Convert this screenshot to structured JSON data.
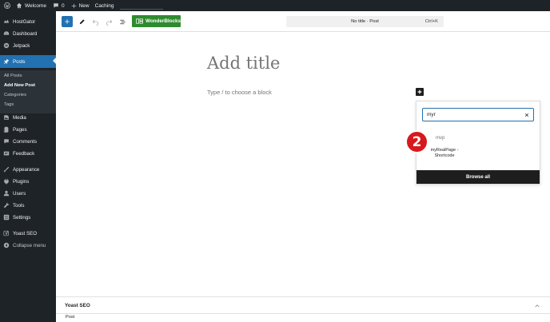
{
  "admin_bar": {
    "site_name": "Welcome",
    "comments_count": "0",
    "new_label": "New",
    "caching_label": "Caching"
  },
  "sidebar": {
    "items": [
      {
        "label": "HostGator",
        "icon": "hostgator-icon"
      },
      {
        "label": "Dashboard",
        "icon": "dashboard-icon"
      },
      {
        "label": "Jetpack",
        "icon": "jetpack-icon"
      },
      {
        "label": "Posts",
        "icon": "pin-icon",
        "active": true
      },
      {
        "label": "Media",
        "icon": "media-icon"
      },
      {
        "label": "Pages",
        "icon": "pages-icon"
      },
      {
        "label": "Comments",
        "icon": "comment-icon"
      },
      {
        "label": "Feedback",
        "icon": "feedback-icon"
      },
      {
        "label": "Appearance",
        "icon": "brush-icon"
      },
      {
        "label": "Plugins",
        "icon": "plug-icon"
      },
      {
        "label": "Users",
        "icon": "user-icon"
      },
      {
        "label": "Tools",
        "icon": "wrench-icon"
      },
      {
        "label": "Settings",
        "icon": "settings-icon"
      },
      {
        "label": "Yoast SEO",
        "icon": "yoast-icon"
      },
      {
        "label": "Collapse menu",
        "icon": "collapse-icon"
      }
    ],
    "submenu": [
      "All Posts",
      "Add New Post",
      "Categories",
      "Tags"
    ]
  },
  "toolbar": {
    "wonderblocks_label": "WonderBlocks",
    "command_title": "No title · Post",
    "command_shortcut": "Ctrl+K"
  },
  "editor": {
    "title_placeholder": "Add title",
    "block_placeholder": "Type / to choose a block"
  },
  "inserter": {
    "search_value": "myr",
    "results": [
      "mvp",
      "myRealPage - Shortcode"
    ],
    "browse_all_label": "Browse all"
  },
  "annotation": {
    "step_number": "2",
    "badge_color": "#d7191d"
  },
  "metabox": {
    "title": "Yoast SEO",
    "footer": "Post"
  },
  "colors": {
    "admin_dark": "#1d2327",
    "accent_blue": "#2271b1",
    "wonderblocks_green": "#2e8b2e"
  }
}
